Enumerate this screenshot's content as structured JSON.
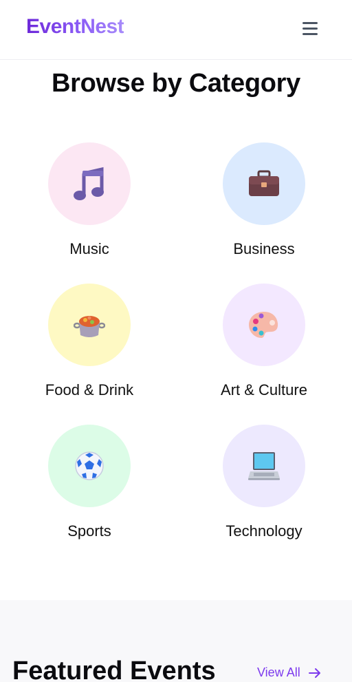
{
  "brand": {
    "name": "EventNest"
  },
  "header": {
    "menu_icon": "hamburger-menu-icon"
  },
  "section": {
    "title": "Browse by Category"
  },
  "categories": [
    {
      "label": "Music",
      "icon": "music-note-icon",
      "bg": "#fce7f3"
    },
    {
      "label": "Business",
      "icon": "briefcase-icon",
      "bg": "#dbeafe"
    },
    {
      "label": "Food & Drink",
      "icon": "stew-pot-icon",
      "bg": "#fef9c3"
    },
    {
      "label": "Art & Culture",
      "icon": "artist-palette-icon",
      "bg": "#f3e8ff"
    },
    {
      "label": "Sports",
      "icon": "soccer-ball-icon",
      "bg": "#dcfce7"
    },
    {
      "label": "Technology",
      "icon": "laptop-icon",
      "bg": "#ede9fe"
    }
  ],
  "featured": {
    "title": "Featured Events",
    "view_all": "View All"
  },
  "colors": {
    "accent": "#7c3aed",
    "text": "#111111"
  }
}
